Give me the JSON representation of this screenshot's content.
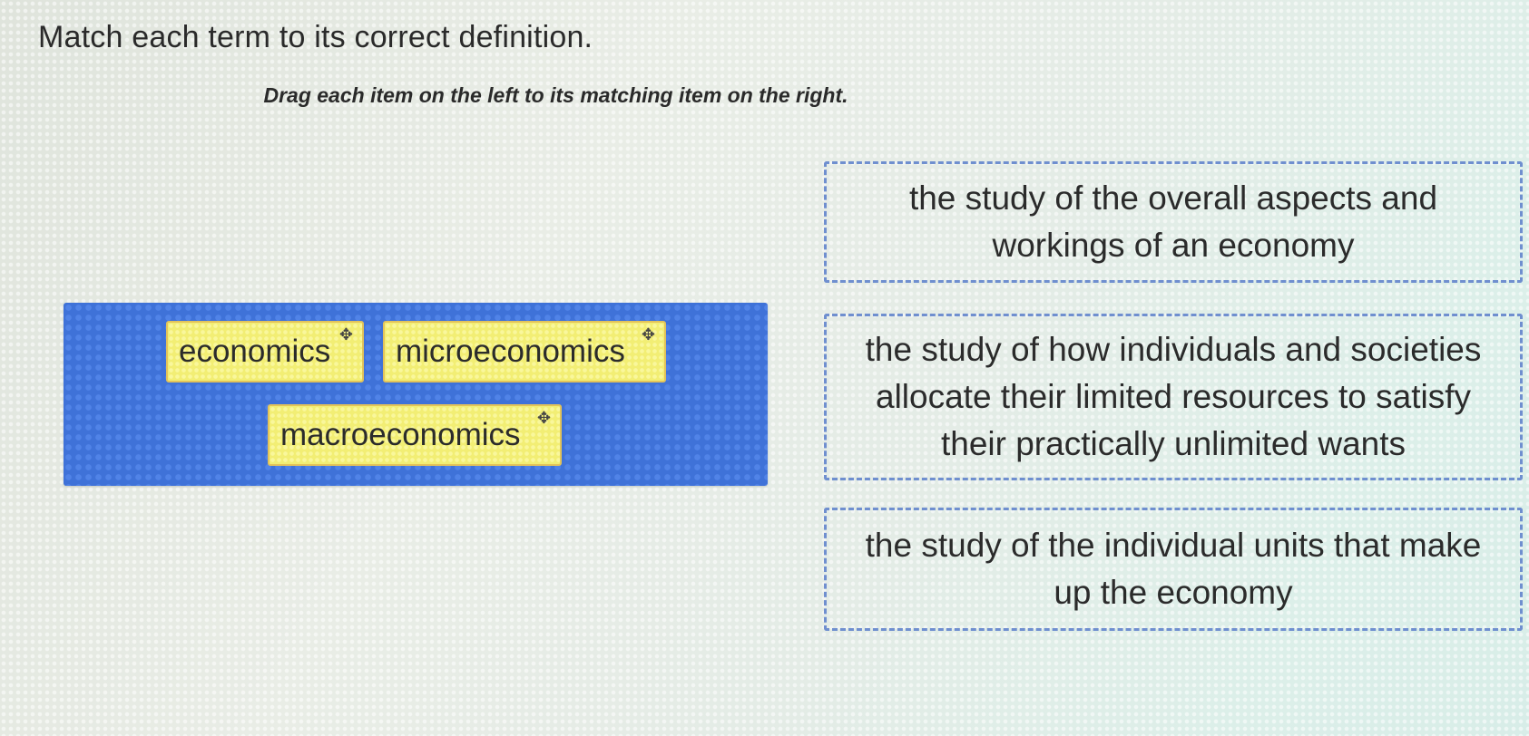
{
  "question": {
    "prompt": "Match each term to its correct definition.",
    "instruction": "Drag each item on the left to its matching item on the right."
  },
  "terms": [
    {
      "label": "economics",
      "icon": "move-icon"
    },
    {
      "label": "microeconomics",
      "icon": "move-icon"
    },
    {
      "label": "macroeconomics",
      "icon": "move-icon"
    }
  ],
  "definitions": [
    {
      "text": "the study of the overall aspects and workings of an economy"
    },
    {
      "text": "the study of how individuals and societies allocate their limited resources to satisfy their practically unlimited wants"
    },
    {
      "text": "the study of the individual units that make up the economy"
    }
  ],
  "colors": {
    "bank": "#3f72d8",
    "chip": "#f2ee74",
    "chip_border": "#e3c35a",
    "target_border": "#6f8fcf"
  },
  "icons": {
    "move": "✥"
  }
}
